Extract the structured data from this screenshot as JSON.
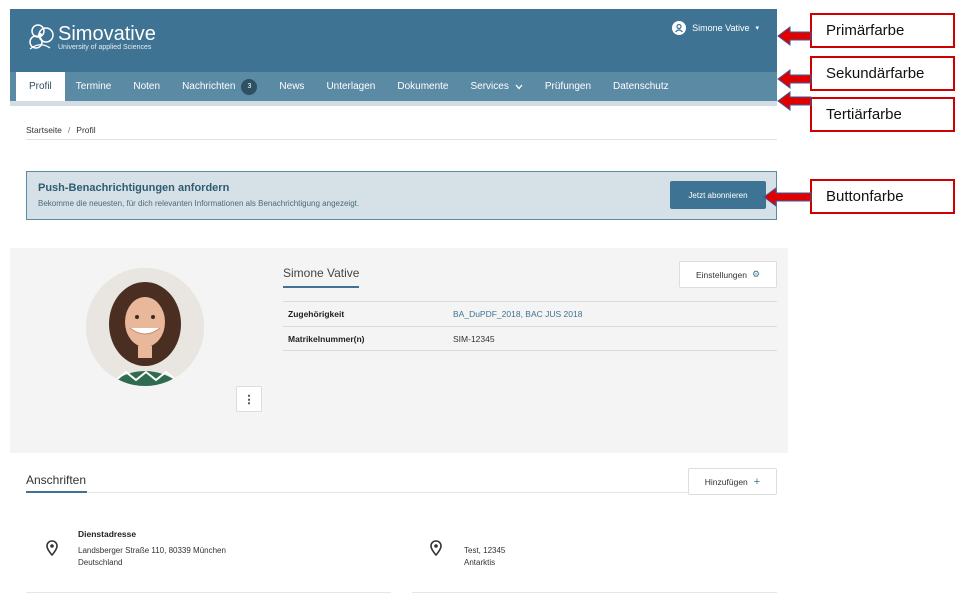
{
  "header": {
    "brand": "Simovative",
    "tagline": "University of applied Sciences",
    "user_name": "Simone Vative"
  },
  "nav": {
    "items": [
      {
        "label": "Profil"
      },
      {
        "label": "Termine"
      },
      {
        "label": "Noten"
      },
      {
        "label": "Nachrichten",
        "badge": "3"
      },
      {
        "label": "News"
      },
      {
        "label": "Unterlagen"
      },
      {
        "label": "Dokumente"
      },
      {
        "label": "Services"
      },
      {
        "label": "Prüfungen"
      },
      {
        "label": "Datenschutz"
      }
    ]
  },
  "breadcrumb": {
    "home": "Startseite",
    "separator": "/",
    "current": "Profil"
  },
  "push": {
    "title": "Push-Benachrichtigungen anfordern",
    "text": "Bekomme die neuesten, für dich relevanten Informationen als Benachrichtigung angezeigt.",
    "button": "Jetzt abonnieren"
  },
  "profile": {
    "name": "Simone Vative",
    "settings_label": "Einstellungen",
    "rows": [
      {
        "key": "Zugehörigkeit",
        "value": "BA_DuPDF_2018, BAC JUS 2018"
      },
      {
        "key": "Matrikelnummer(n)",
        "value": "SIM-12345"
      }
    ]
  },
  "addresses": {
    "title": "Anschriften",
    "add_label": "Hinzufügen",
    "items": [
      {
        "label": "Dienstadresse",
        "line1": "Landsberger Straße 110, 80339 München",
        "line2": "Deutschland"
      },
      {
        "label": "",
        "line1": "Test, 12345",
        "line2": "Antarktis"
      }
    ]
  },
  "callouts": {
    "primary": "Primärfarbe",
    "secondary": "Sekundärfarbe",
    "tertiary": "Tertiärfarbe",
    "button": "Buttonfarbe"
  },
  "colors": {
    "primary": "#3e7393",
    "secondary": "#5b8aa5",
    "tertiary": "#d3dde3",
    "button": "#3e7393",
    "arrow": "#e00000"
  }
}
